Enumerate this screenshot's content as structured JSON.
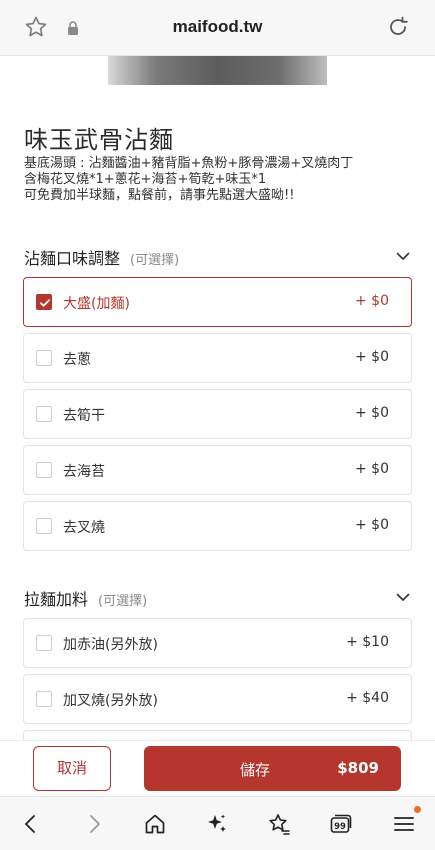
{
  "browser": {
    "url": "maifood.tw",
    "bottom_nav": {
      "tabs_count": "99",
      "icons": [
        "back-icon",
        "forward-icon",
        "home-icon",
        "sparkle-icon",
        "favorites-icon",
        "tabs-icon",
        "menu-icon"
      ]
    }
  },
  "item": {
    "title": "味玉武骨沾麵",
    "description": [
      "基底湯頭 : 沾麵醬油+豬背脂+魚粉+豚骨濃湯+叉燒肉丁",
      "含梅花叉燒*1+蔥花+海苔+筍乾+味玉*1",
      "可免費加半球麵，點餐前，請事先點選大盛呦!!"
    ]
  },
  "sections": [
    {
      "label": "沾麵口味調整",
      "optional": "(可選擇)",
      "options": [
        {
          "name": "大盛(加麵)",
          "price": "+ $0",
          "selected": true
        },
        {
          "name": "去蔥",
          "price": "+ $0",
          "selected": false
        },
        {
          "name": "去筍干",
          "price": "+ $0",
          "selected": false
        },
        {
          "name": "去海苔",
          "price": "+ $0",
          "selected": false
        },
        {
          "name": "去叉燒",
          "price": "+ $0",
          "selected": false
        }
      ]
    },
    {
      "label": "拉麵加料",
      "optional": "(可選擇)",
      "options": [
        {
          "name": "加赤油(另外放)",
          "price": "+ $10",
          "selected": false
        },
        {
          "name": "加叉燒(另外放)",
          "price": "+ $40",
          "selected": false
        }
      ]
    }
  ],
  "actions": {
    "cancel_label": "取消",
    "save_label": "儲存",
    "total": "$809"
  },
  "colors": {
    "accent": "#b5362c",
    "notification_dot": "#e8712b"
  }
}
